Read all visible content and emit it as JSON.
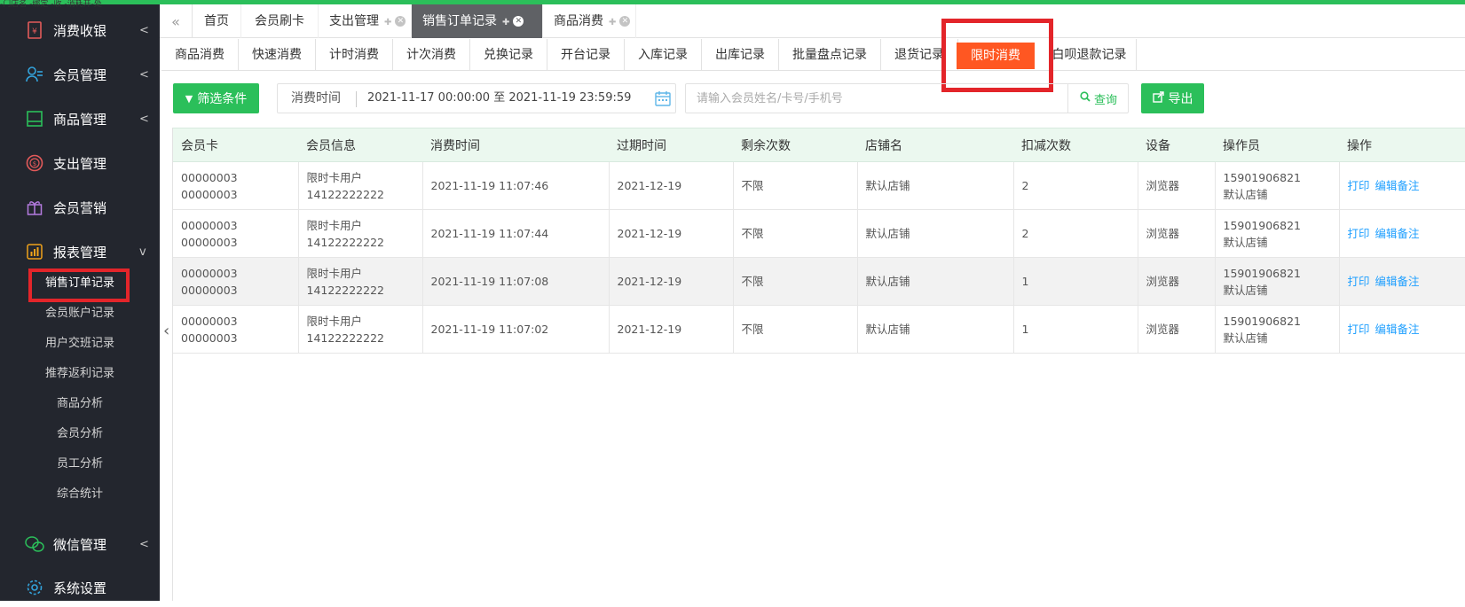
{
  "top_cut_text": "-门店名 -绑定 -收 -消耗开-处",
  "sidebar": {
    "menu": [
      {
        "label": "消费收银",
        "icon": "cashier-icon",
        "arrow": "<"
      },
      {
        "label": "会员管理",
        "icon": "member-icon",
        "arrow": "<"
      },
      {
        "label": "商品管理",
        "icon": "goods-icon",
        "arrow": "<"
      },
      {
        "label": "支出管理",
        "icon": "expense-icon",
        "arrow": ""
      },
      {
        "label": "会员营销",
        "icon": "gift-icon",
        "arrow": ""
      },
      {
        "label": "报表管理",
        "icon": "report-icon",
        "arrow": "v"
      }
    ],
    "sub": [
      "销售订单记录",
      "会员账户记录",
      "用户交班记录",
      "推荐返利记录",
      "商品分析",
      "会员分析",
      "员工分析",
      "综合统计"
    ],
    "bottom": [
      {
        "label": "微信管理",
        "icon": "wechat-icon",
        "arrow": "<"
      },
      {
        "label": "系统设置",
        "icon": "settings-icon",
        "arrow": ""
      }
    ]
  },
  "tabs": [
    {
      "label": "首页"
    },
    {
      "label": "会员刷卡"
    },
    {
      "label": "支出管理"
    },
    {
      "label": "销售订单记录"
    },
    {
      "label": "商品消费"
    }
  ],
  "subtabs": [
    "商品消费",
    "快速消费",
    "计时消费",
    "计次消费",
    "兑换记录",
    "开台记录",
    "入库记录",
    "出库记录",
    "批量盘点记录",
    "退货记录",
    "限时消费",
    "白呗退款记录"
  ],
  "filter": {
    "button": "筛选条件",
    "date_label": "消费时间",
    "date_value": "2021-11-17 00:00:00 至 2021-11-19 23:59:59",
    "search_placeholder": "请输入会员姓名/卡号/手机号",
    "search_button": "查询",
    "export_button": "导出"
  },
  "table": {
    "headers": [
      "会员卡",
      "会员信息",
      "消费时间",
      "过期时间",
      "剩余次数",
      "店铺名",
      "扣减次数",
      "设备",
      "操作员",
      "操作"
    ],
    "rows": [
      {
        "card1": "00000003",
        "card2": "00000003",
        "info1": "限时卡用户",
        "info2": "14122222222",
        "time": "2021-11-19 11:07:46",
        "expire": "2021-12-19",
        "remain": "不限",
        "shop": "默认店铺",
        "deduct": "2",
        "device": "浏览器",
        "op1": "15901906821",
        "op2": "默认店铺"
      },
      {
        "card1": "00000003",
        "card2": "00000003",
        "info1": "限时卡用户",
        "info2": "14122222222",
        "time": "2021-11-19 11:07:44",
        "expire": "2021-12-19",
        "remain": "不限",
        "shop": "默认店铺",
        "deduct": "2",
        "device": "浏览器",
        "op1": "15901906821",
        "op2": "默认店铺"
      },
      {
        "card1": "00000003",
        "card2": "00000003",
        "info1": "限时卡用户",
        "info2": "14122222222",
        "time": "2021-11-19 11:07:08",
        "expire": "2021-12-19",
        "remain": "不限",
        "shop": "默认店铺",
        "deduct": "1",
        "device": "浏览器",
        "op1": "15901906821",
        "op2": "默认店铺"
      },
      {
        "card1": "00000003",
        "card2": "00000003",
        "info1": "限时卡用户",
        "info2": "14122222222",
        "time": "2021-11-19 11:07:02",
        "expire": "2021-12-19",
        "remain": "不限",
        "shop": "默认店铺",
        "deduct": "1",
        "device": "浏览器",
        "op1": "15901906821",
        "op2": "默认店铺"
      }
    ],
    "action_print": "打印",
    "action_edit": "编辑备注"
  },
  "colors": {
    "brand_green": "#2bbf5a",
    "active_orange": "#ff5722",
    "sidebar_bg": "#23262e",
    "highlight_red": "#e3252a",
    "link_blue": "#1e9fff"
  }
}
